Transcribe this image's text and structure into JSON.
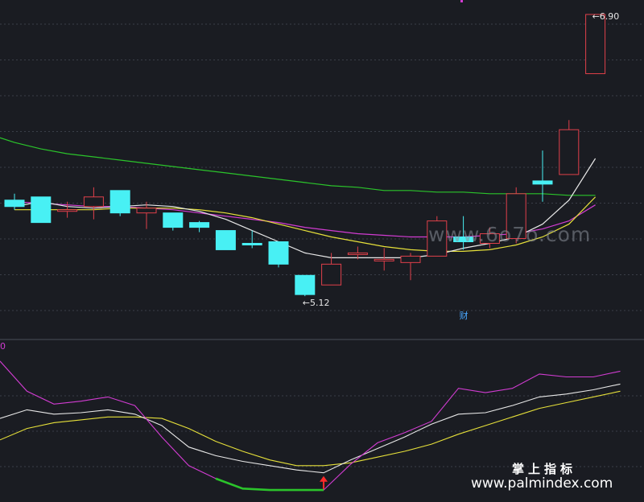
{
  "chart_data": [
    {
      "type": "candlestick",
      "ylim": [
        5.0,
        6.95
      ],
      "colors": {
        "up": "#e0404a",
        "down": "#48f0f4",
        "ma_white": "#e8e8e8",
        "ma_yellow": "#e6e03a",
        "ma_magenta": "#d23cd2",
        "ma_green": "#2bc42b"
      },
      "candles": [
        {
          "o": 5.74,
          "h": 5.78,
          "l": 5.68,
          "c": 5.7
        },
        {
          "o": 5.76,
          "h": 5.76,
          "l": 5.6,
          "c": 5.6
        },
        {
          "o": 5.67,
          "h": 5.73,
          "l": 5.63,
          "c": 5.68
        },
        {
          "o": 5.7,
          "h": 5.82,
          "l": 5.62,
          "c": 5.76
        },
        {
          "o": 5.8,
          "h": 5.8,
          "l": 5.64,
          "c": 5.66
        },
        {
          "o": 5.66,
          "h": 5.73,
          "l": 5.56,
          "c": 5.69
        },
        {
          "o": 5.66,
          "h": 5.66,
          "l": 5.55,
          "c": 5.57
        },
        {
          "o": 5.6,
          "h": 5.61,
          "l": 5.54,
          "c": 5.57
        },
        {
          "o": 5.55,
          "h": 5.55,
          "l": 5.43,
          "c": 5.43
        },
        {
          "o": 5.47,
          "h": 5.55,
          "l": 5.44,
          "c": 5.46
        },
        {
          "o": 5.48,
          "h": 5.48,
          "l": 5.32,
          "c": 5.34
        },
        {
          "o": 5.27,
          "h": 5.27,
          "l": 5.14,
          "c": 5.15
        },
        {
          "o": 5.21,
          "h": 5.41,
          "l": 5.21,
          "c": 5.34
        },
        {
          "o": 5.4,
          "h": 5.45,
          "l": 5.37,
          "c": 5.41
        },
        {
          "o": 5.37,
          "h": 5.44,
          "l": 5.3,
          "c": 5.37
        },
        {
          "o": 5.35,
          "h": 5.41,
          "l": 5.24,
          "c": 5.39
        },
        {
          "o": 5.39,
          "h": 5.64,
          "l": 5.39,
          "c": 5.61
        },
        {
          "o": 5.51,
          "h": 5.64,
          "l": 5.43,
          "c": 5.48
        },
        {
          "o": 5.47,
          "h": 5.57,
          "l": 5.44,
          "c": 5.53
        },
        {
          "o": 5.5,
          "h": 5.82,
          "l": 5.47,
          "c": 5.78
        },
        {
          "o": 5.86,
          "h": 6.05,
          "l": 5.73,
          "c": 5.84
        },
        {
          "o": 5.9,
          "h": 6.24,
          "l": 5.9,
          "c": 6.18
        },
        {
          "o": 6.53,
          "h": 6.9,
          "l": 6.53,
          "c": 6.9
        }
      ],
      "ma_white": [
        5.7,
        5.73,
        5.7,
        5.69,
        5.7,
        5.71,
        5.7,
        5.67,
        5.62,
        5.55,
        5.48,
        5.41,
        5.38,
        5.38,
        5.38,
        5.38,
        5.4,
        5.44,
        5.47,
        5.51,
        5.59,
        5.74,
        6.0
      ],
      "ma_yellow": [
        5.68,
        5.68,
        5.68,
        5.68,
        5.69,
        5.69,
        5.69,
        5.68,
        5.66,
        5.63,
        5.59,
        5.55,
        5.51,
        5.48,
        5.45,
        5.43,
        5.42,
        5.42,
        5.43,
        5.46,
        5.51,
        5.59,
        5.76
      ],
      "ma_magenta": [
        5.73,
        5.72,
        5.71,
        5.7,
        5.7,
        5.69,
        5.68,
        5.66,
        5.64,
        5.62,
        5.6,
        5.57,
        5.55,
        5.53,
        5.52,
        5.51,
        5.51,
        5.51,
        5.52,
        5.53,
        5.56,
        5.61,
        5.71
      ],
      "ma_green": [
        6.1,
        6.06,
        6.03,
        6.01,
        5.99,
        5.97,
        5.95,
        5.93,
        5.91,
        5.89,
        5.87,
        5.85,
        5.83,
        5.82,
        5.8,
        5.8,
        5.79,
        5.79,
        5.78,
        5.78,
        5.78,
        5.77,
        5.77
      ],
      "annotations": [
        {
          "text": "5.12",
          "index": 11,
          "value": 5.14
        },
        {
          "text": "6.90",
          "index": 22,
          "value": 6.9
        },
        {
          "text": "财",
          "index": 17,
          "value": 5.05
        }
      ]
    },
    {
      "type": "line",
      "ylim": [
        0,
        100
      ],
      "series_magenta": [
        95,
        74,
        65,
        67,
        70,
        64,
        42,
        22,
        13,
        6,
        5,
        5,
        5,
        23,
        38,
        45,
        53,
        76,
        73,
        76,
        86,
        84,
        84,
        88
      ],
      "series_white": [
        55,
        61,
        58,
        59,
        61,
        58,
        50,
        35,
        29,
        25,
        22,
        19,
        17,
        26,
        34,
        42,
        51,
        58,
        59,
        64,
        70,
        72,
        75,
        79
      ],
      "series_yellow": [
        40,
        48,
        52,
        54,
        56,
        56,
        55,
        48,
        39,
        32,
        26,
        22,
        22,
        24,
        28,
        32,
        37,
        44,
        50,
        56,
        62,
        66,
        70,
        74
      ],
      "green_segment": [
        8,
        12
      ],
      "signal_index": 12,
      "edge_label": "0"
    }
  ],
  "watermarks": {
    "site": "www.6o7o.com",
    "brand_cn": "掌上指标",
    "brand_url": "www.palmindex.com"
  }
}
